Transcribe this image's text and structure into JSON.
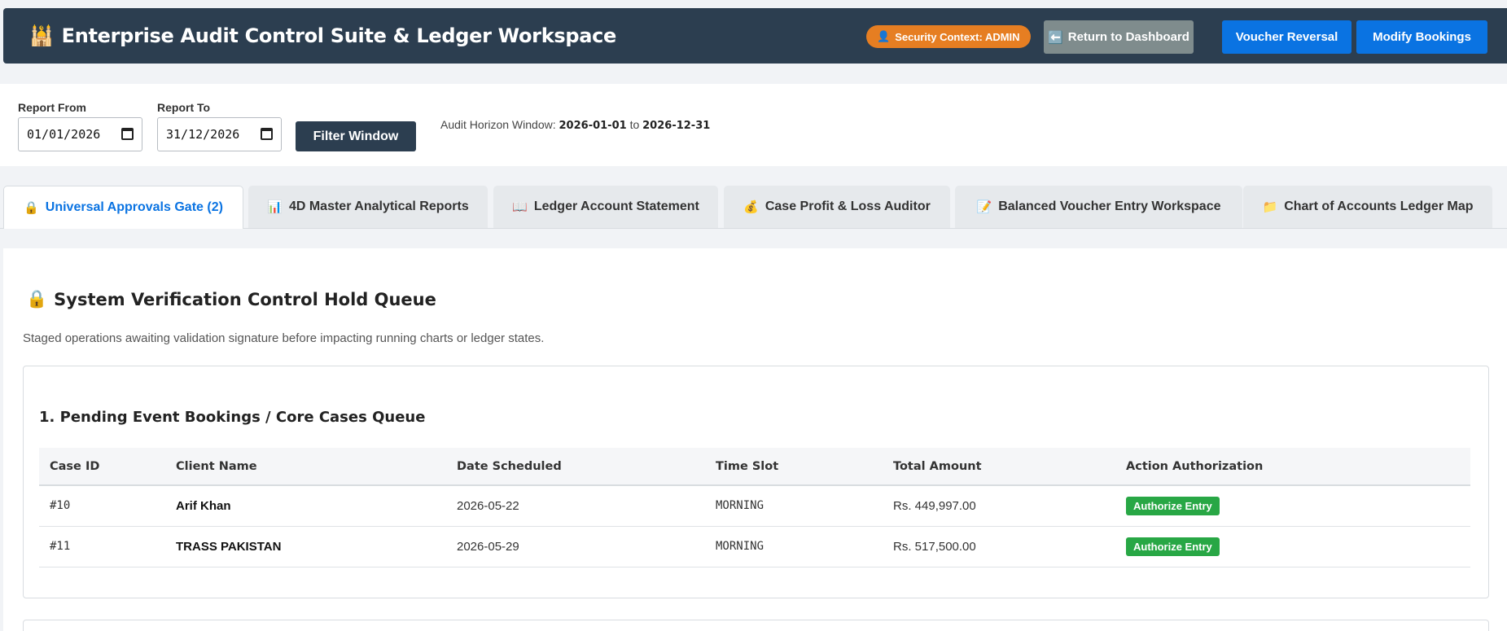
{
  "header": {
    "title": "Enterprise Audit Control Suite & Ledger Workspace",
    "logo_icon": "🕌",
    "security_context": "Security Context: ADMIN",
    "security_icon": "👤",
    "return_label": "Return to Dashboard",
    "return_icon": "⬅️",
    "reversal_label": "Voucher Reversal",
    "modify_label": "Modify Bookings"
  },
  "filter": {
    "from_label": "Report From",
    "from_value": "01/01/2026",
    "to_label": "Report To",
    "to_value": "31/12/2026",
    "button": "Filter Window",
    "horizon_prefix": "Audit Horizon Window:",
    "horizon_start": "2026-01-01",
    "horizon_mid": "to",
    "horizon_end": "2026-12-31"
  },
  "tabs": [
    {
      "icon": "🔒",
      "label": "Universal Approvals Gate (2)"
    },
    {
      "icon": "📊",
      "label": "4D Master Analytical Reports"
    },
    {
      "icon": "📖",
      "label": "Ledger Account Statement"
    },
    {
      "icon": "💰",
      "label": "Case Profit & Loss Auditor"
    },
    {
      "icon": "📝",
      "label": "Balanced Voucher Entry Workspace"
    },
    {
      "icon": "📁",
      "label": "Chart of Accounts Ledger Map"
    }
  ],
  "section": {
    "icon": "🔒",
    "title": "System Verification Control Hold Queue",
    "subtitle": "Staged operations awaiting validation signature before impacting running charts or ledger states."
  },
  "queue": {
    "title": "1. Pending Event Bookings / Core Cases Queue",
    "columns": [
      "Case ID",
      "Client Name",
      "Date Scheduled",
      "Time Slot",
      "Total Amount",
      "Action Authorization"
    ],
    "rows": [
      {
        "id": "#10",
        "client": "Arif Khan",
        "date": "2026-05-22",
        "slot": "MORNING",
        "amount": "Rs. 449,997.00",
        "action": "Authorize Entry"
      },
      {
        "id": "#11",
        "client": "TRASS PAKISTAN",
        "date": "2026-05-29",
        "slot": "MORNING",
        "amount": "Rs. 517,500.00",
        "action": "Authorize Entry"
      }
    ]
  },
  "colors": {
    "header_bg": "#2c3e50",
    "accent": "#0a73e2",
    "badge": "#e67e22",
    "success": "#28a745"
  }
}
